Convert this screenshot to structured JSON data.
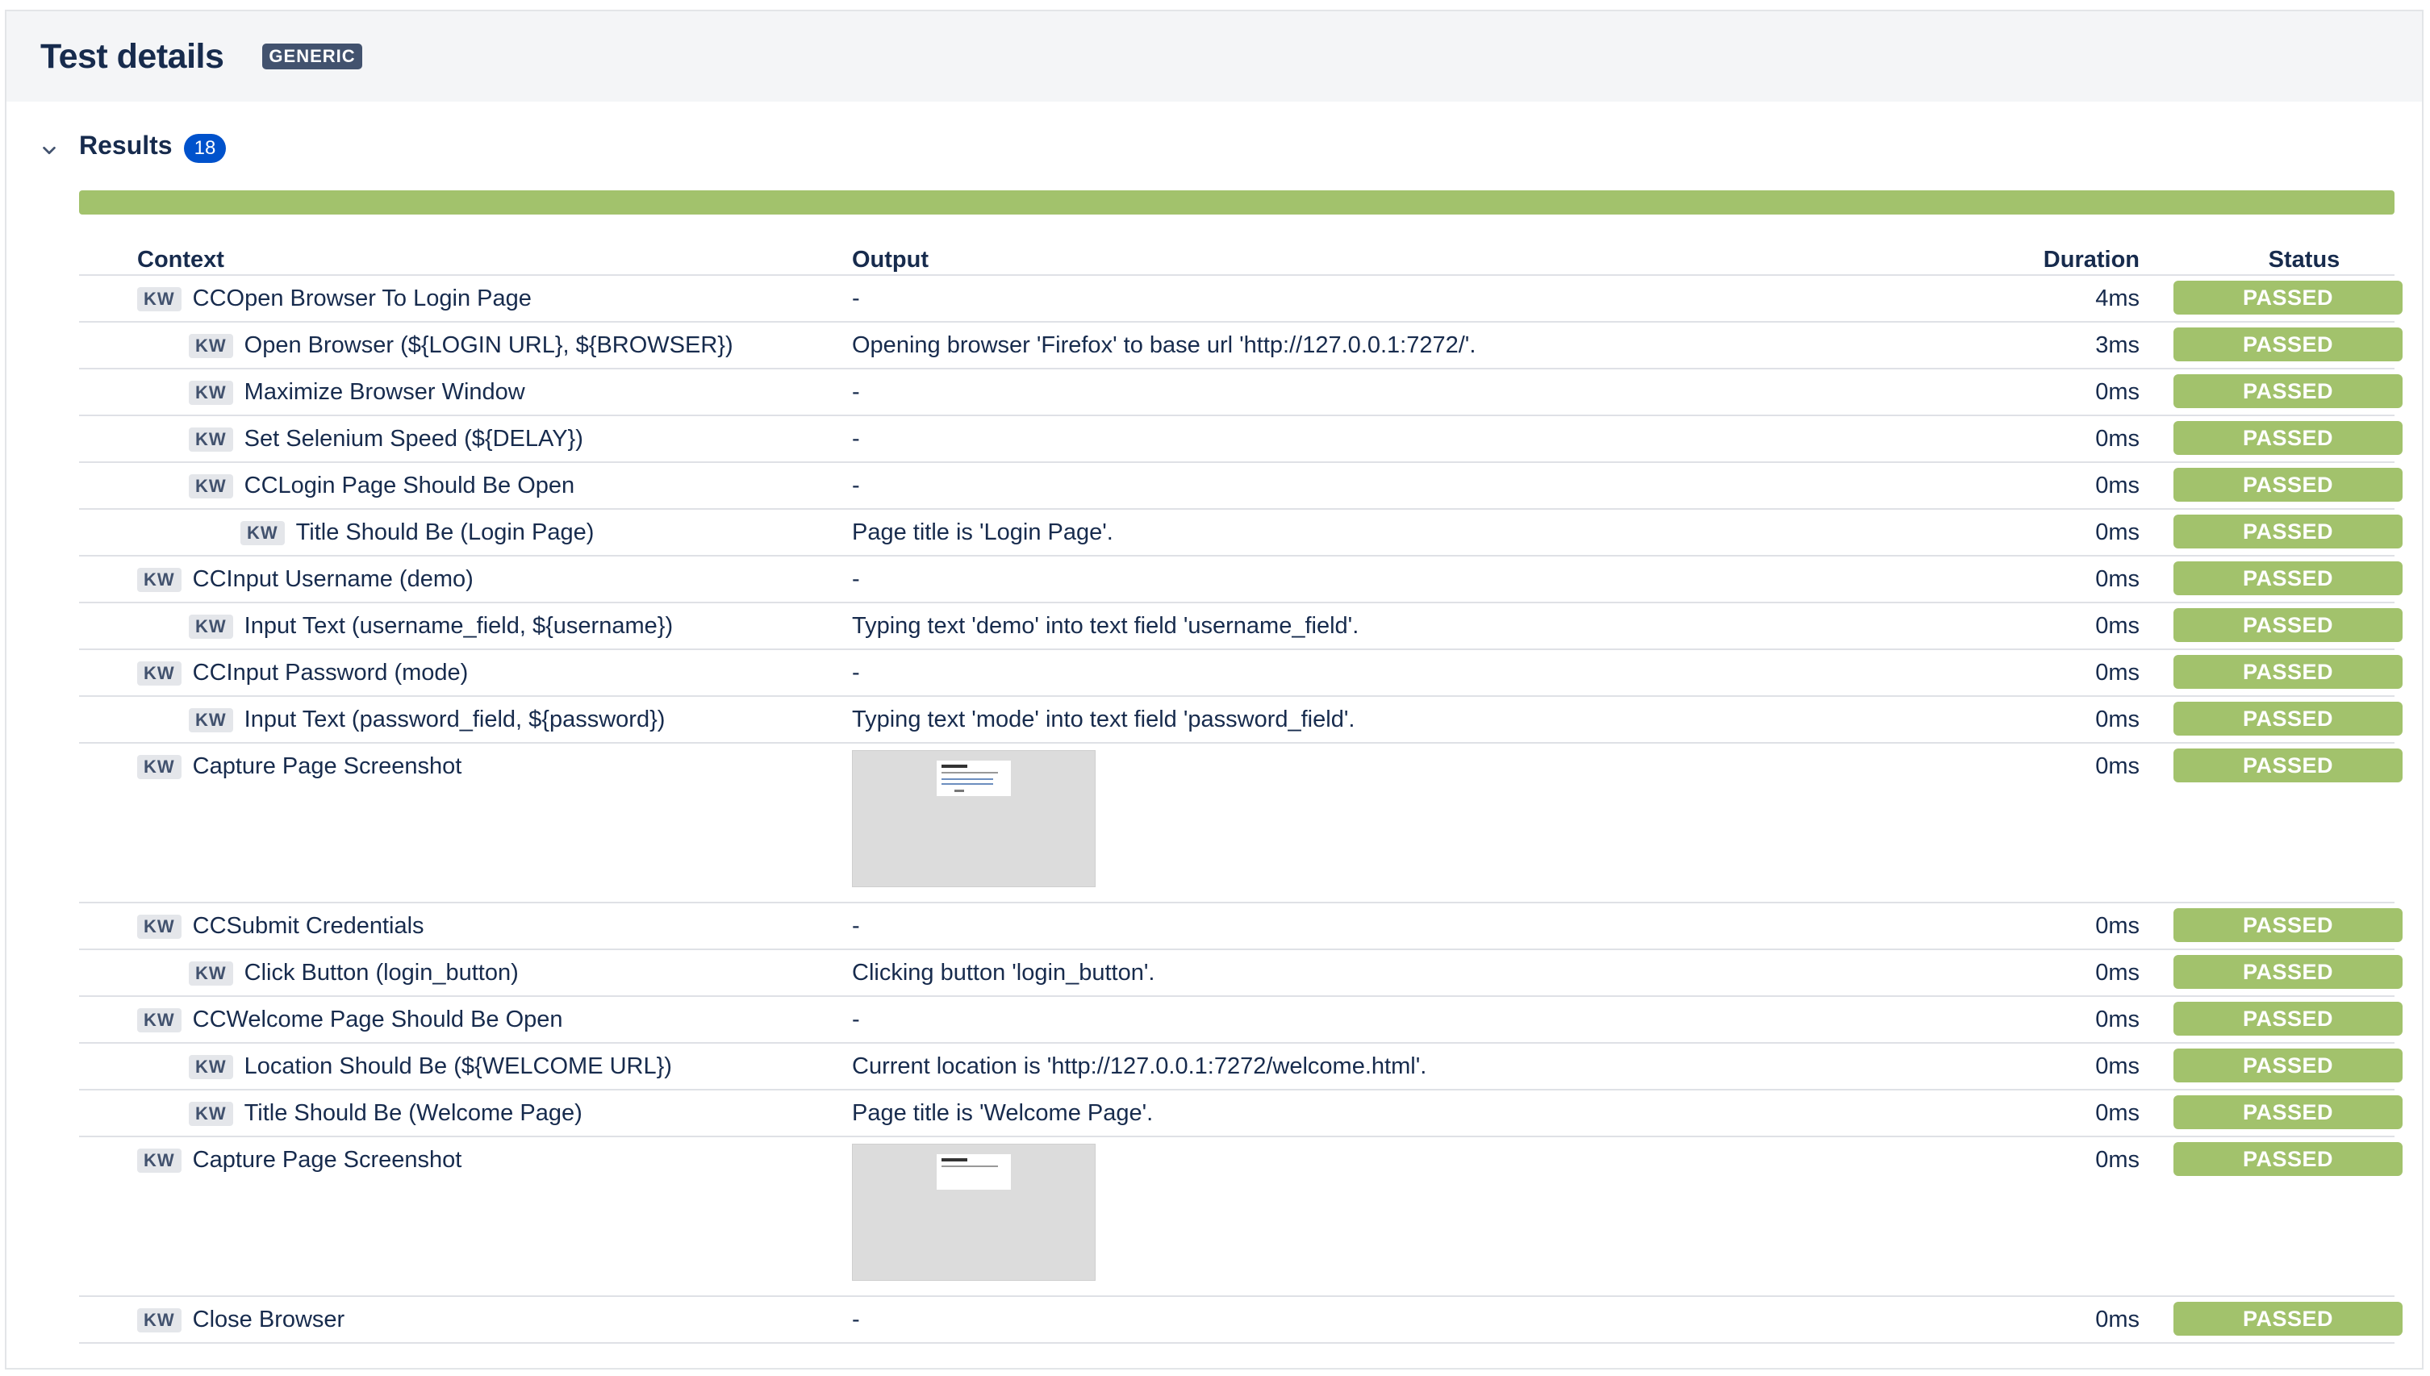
{
  "panel": {
    "title": "Test details",
    "type_badge": "GENERIC"
  },
  "results": {
    "label": "Results",
    "count": "18",
    "progress_passed_fraction": 1.0
  },
  "colors": {
    "passed": "#a2c26c",
    "badge_blue": "#0052cc",
    "lozenge_dark": "#42526e"
  },
  "columns": {
    "context": "Context",
    "output": "Output",
    "duration": "Duration",
    "status": "Status"
  },
  "kw_label": "KW",
  "rows": [
    {
      "level": 0,
      "context": "CCOpen Browser To Login Page",
      "output": "-",
      "duration": "4ms",
      "status": "PASSED"
    },
    {
      "level": 1,
      "context": "Open Browser (${LOGIN URL}, ${BROWSER})",
      "output": "Opening browser 'Firefox' to base url 'http://127.0.0.1:7272/'.",
      "duration": "3ms",
      "status": "PASSED"
    },
    {
      "level": 1,
      "context": "Maximize Browser Window",
      "output": "-",
      "duration": "0ms",
      "status": "PASSED"
    },
    {
      "level": 1,
      "context": "Set Selenium Speed (${DELAY})",
      "output": "-",
      "duration": "0ms",
      "status": "PASSED"
    },
    {
      "level": 1,
      "context": "CCLogin Page Should Be Open",
      "output": "-",
      "duration": "0ms",
      "status": "PASSED"
    },
    {
      "level": 2,
      "context": "Title Should Be (Login Page)",
      "output": "Page title is 'Login Page'.",
      "duration": "0ms",
      "status": "PASSED"
    },
    {
      "level": 0,
      "context": "CCInput Username (demo)",
      "output": "-",
      "duration": "0ms",
      "status": "PASSED"
    },
    {
      "level": 1,
      "context": "Input Text (username_field, ${username})",
      "output": "Typing text 'demo' into text field 'username_field'.",
      "duration": "0ms",
      "status": "PASSED"
    },
    {
      "level": 0,
      "context": "CCInput Password (mode)",
      "output": "-",
      "duration": "0ms",
      "status": "PASSED"
    },
    {
      "level": 1,
      "context": "Input Text (password_field, ${password})",
      "output": "Typing text 'mode' into text field 'password_field'.",
      "duration": "0ms",
      "status": "PASSED"
    },
    {
      "level": 0,
      "context": "Capture Page Screenshot",
      "output": "",
      "screenshot": "login",
      "duration": "0ms",
      "status": "PASSED"
    },
    {
      "level": 0,
      "context": "CCSubmit Credentials",
      "output": "-",
      "duration": "0ms",
      "status": "PASSED"
    },
    {
      "level": 1,
      "context": "Click Button (login_button)",
      "output": "Clicking button 'login_button'.",
      "duration": "0ms",
      "status": "PASSED"
    },
    {
      "level": 0,
      "context": "CCWelcome Page Should Be Open",
      "output": "-",
      "duration": "0ms",
      "status": "PASSED"
    },
    {
      "level": 1,
      "context": "Location Should Be (${WELCOME URL})",
      "output": "Current location is 'http://127.0.0.1:7272/welcome.html'.",
      "duration": "0ms",
      "status": "PASSED"
    },
    {
      "level": 1,
      "context": "Title Should Be (Welcome Page)",
      "output": "Page title is 'Welcome Page'.",
      "duration": "0ms",
      "status": "PASSED"
    },
    {
      "level": 0,
      "context": "Capture Page Screenshot",
      "output": "",
      "screenshot": "welcome",
      "duration": "0ms",
      "status": "PASSED"
    },
    {
      "level": 0,
      "context": "Close Browser",
      "output": "-",
      "duration": "0ms",
      "status": "PASSED"
    }
  ]
}
